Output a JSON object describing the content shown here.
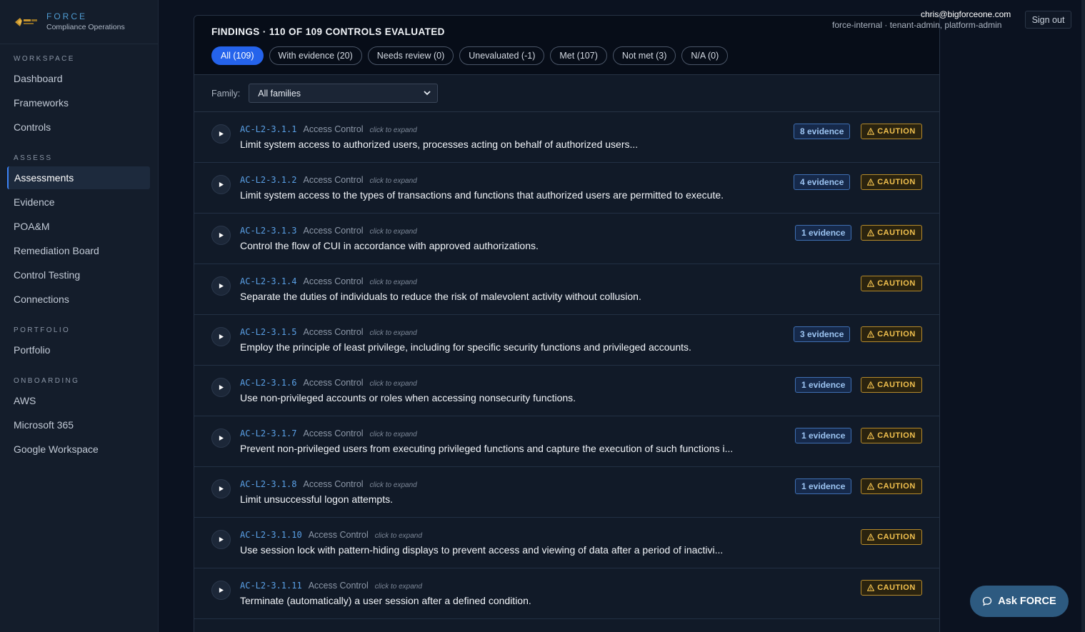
{
  "brand": {
    "name": "FORCE",
    "subtitle": "Compliance Operations"
  },
  "sidebar": {
    "sections": [
      {
        "label": "WORKSPACE",
        "items": [
          "Dashboard",
          "Frameworks",
          "Controls"
        ]
      },
      {
        "label": "ASSESS",
        "items": [
          "Assessments",
          "Evidence",
          "POA&M",
          "Remediation Board",
          "Control Testing",
          "Connections"
        ]
      },
      {
        "label": "PORTFOLIO",
        "items": [
          "Portfolio"
        ]
      },
      {
        "label": "ONBOARDING",
        "items": [
          "AWS",
          "Microsoft 365",
          "Google Workspace"
        ]
      }
    ],
    "active_item": "Assessments"
  },
  "user": {
    "email": "chris@bigforceone.com",
    "roles": "force-internal · tenant-admin, platform-admin",
    "sign_out": "Sign out"
  },
  "findings": {
    "title": "FINDINGS · 110 OF 109 CONTROLS EVALUATED",
    "filters": [
      {
        "label": "All (109)",
        "active": true
      },
      {
        "label": "With evidence (20)",
        "active": false
      },
      {
        "label": "Needs review (0)",
        "active": false
      },
      {
        "label": "Unevaluated (-1)",
        "active": false
      },
      {
        "label": "Met (107)",
        "active": false
      },
      {
        "label": "Not met (3)",
        "active": false
      },
      {
        "label": "N/A (0)",
        "active": false
      }
    ],
    "family_label": "Family:",
    "family_value": "All families",
    "rows": [
      {
        "id": "AC-L2-3.1.1",
        "family": "Access Control",
        "hint": "click to expand",
        "desc": "Limit system access to authorized users, processes acting on behalf of authorized users...",
        "evidence": "8 evidence",
        "status": "CAUTION"
      },
      {
        "id": "AC-L2-3.1.2",
        "family": "Access Control",
        "hint": "click to expand",
        "desc": "Limit system access to the types of transactions and functions that authorized users are permitted to execute.",
        "evidence": "4 evidence",
        "status": "CAUTION"
      },
      {
        "id": "AC-L2-3.1.3",
        "family": "Access Control",
        "hint": "click to expand",
        "desc": "Control the flow of CUI in accordance with approved authorizations.",
        "evidence": "1 evidence",
        "status": "CAUTION"
      },
      {
        "id": "AC-L2-3.1.4",
        "family": "Access Control",
        "hint": "click to expand",
        "desc": "Separate the duties of individuals to reduce the risk of malevolent activity without collusion.",
        "evidence": "",
        "status": "CAUTION"
      },
      {
        "id": "AC-L2-3.1.5",
        "family": "Access Control",
        "hint": "click to expand",
        "desc": "Employ the principle of least privilege, including for specific security functions and privileged accounts.",
        "evidence": "3 evidence",
        "status": "CAUTION"
      },
      {
        "id": "AC-L2-3.1.6",
        "family": "Access Control",
        "hint": "click to expand",
        "desc": "Use non-privileged accounts or roles when accessing nonsecurity functions.",
        "evidence": "1 evidence",
        "status": "CAUTION"
      },
      {
        "id": "AC-L2-3.1.7",
        "family": "Access Control",
        "hint": "click to expand",
        "desc": "Prevent non-privileged users from executing privileged functions and capture the execution of such functions i...",
        "evidence": "1 evidence",
        "status": "CAUTION"
      },
      {
        "id": "AC-L2-3.1.8",
        "family": "Access Control",
        "hint": "click to expand",
        "desc": "Limit unsuccessful logon attempts.",
        "evidence": "1 evidence",
        "status": "CAUTION"
      },
      {
        "id": "AC-L2-3.1.10",
        "family": "Access Control",
        "hint": "click to expand",
        "desc": "Use session lock with pattern-hiding displays to prevent access and viewing of data after a period of inactivi...",
        "evidence": "",
        "status": "CAUTION"
      },
      {
        "id": "AC-L2-3.1.11",
        "family": "Access Control",
        "hint": "click to expand",
        "desc": "Terminate (automatically) a user session after a defined condition.",
        "evidence": "",
        "status": "CAUTION"
      }
    ]
  },
  "assistant": {
    "label": "Ask FORCE"
  },
  "colors": {
    "accent": "#2563eb",
    "caution": "#f2c14e",
    "link": "#5aa0e6"
  }
}
